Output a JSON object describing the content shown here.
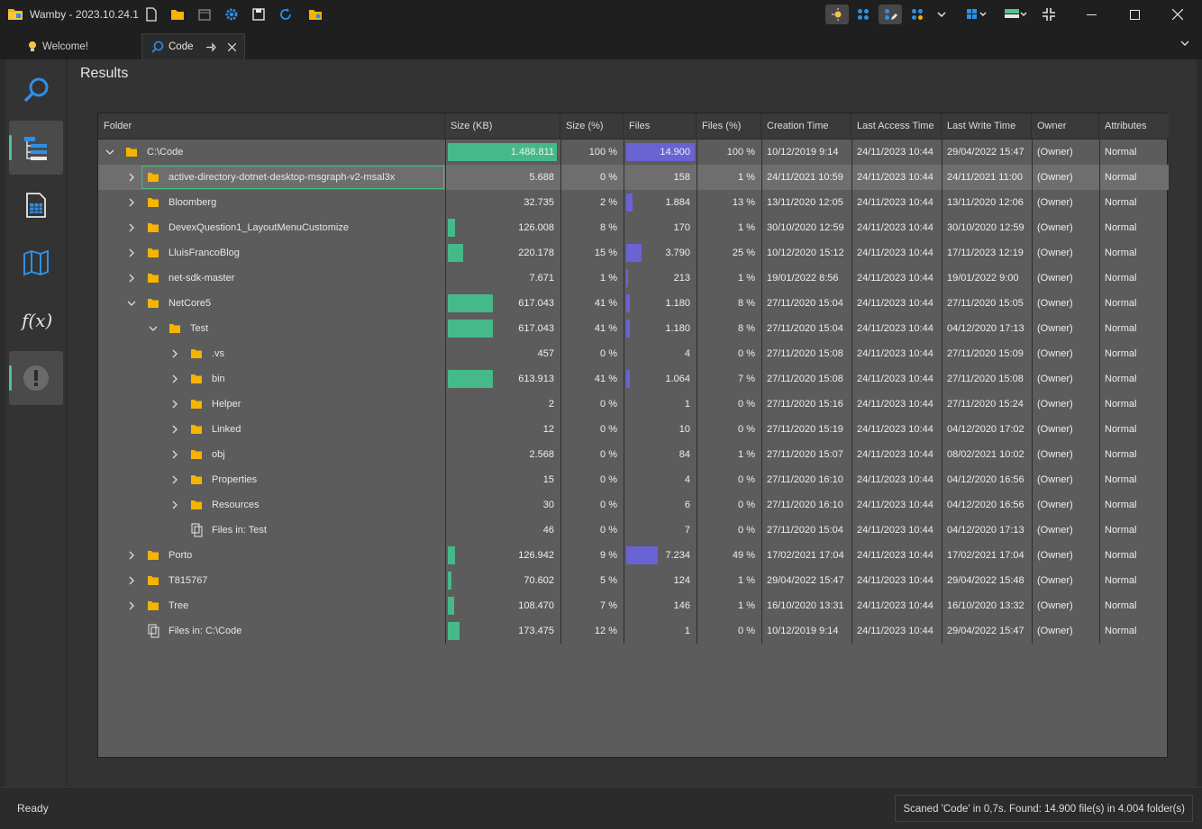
{
  "window": {
    "title": "Wamby - 2023.10.24.1"
  },
  "tabs": [
    {
      "label": "Welcome!"
    },
    {
      "label": "Code"
    }
  ],
  "main": {
    "title": "Results"
  },
  "grid": {
    "columns": [
      "Folder",
      "Size (KB)",
      "Size (%)",
      "Files",
      "Files (%)",
      "Creation Time",
      "Last Access Time",
      "Last Write Time",
      "Owner",
      "Attributes"
    ],
    "rows": [
      {
        "name": "C:\\Code",
        "level": 0,
        "expander": "expanded",
        "icon": "folder",
        "size": "1.488.811",
        "size_pct": "100 %",
        "size_frac": 1.0,
        "files": "14.900",
        "files_pct": "100 %",
        "files_frac": 1.0,
        "created": "10/12/2019 9:14",
        "accessed": "24/11/2023 10:44",
        "written": "29/04/2022 15:47",
        "owner": "(Owner)",
        "attr": "Normal"
      },
      {
        "name": "active-directory-dotnet-desktop-msgraph-v2-msal3x",
        "level": 1,
        "expander": "collapsed",
        "icon": "folder",
        "selected": true,
        "size": "5.688",
        "size_pct": "0 %",
        "size_frac": 0.0,
        "files": "158",
        "files_pct": "1 %",
        "files_frac": 0.0,
        "created": "24/11/2021 10:59",
        "accessed": "24/11/2023 10:44",
        "written": "24/11/2021 11:00",
        "owner": "(Owner)",
        "attr": "Normal"
      },
      {
        "name": "Bloomberg",
        "level": 1,
        "expander": "collapsed",
        "icon": "folder",
        "size": "32.735",
        "size_pct": "2 %",
        "size_frac": 0.0,
        "files": "1.884",
        "files_pct": "13 %",
        "files_frac": 0.09,
        "created": "13/11/2020 12:05",
        "accessed": "24/11/2023 10:44",
        "written": "13/11/2020 12:06",
        "owner": "(Owner)",
        "attr": "Normal"
      },
      {
        "name": "DevexQuestion1_LayoutMenuCustomize",
        "level": 1,
        "expander": "collapsed",
        "icon": "folder",
        "size": "126.008",
        "size_pct": "8 %",
        "size_frac": 0.07,
        "files": "170",
        "files_pct": "1 %",
        "files_frac": 0.0,
        "created": "30/10/2020 12:59",
        "accessed": "24/11/2023 10:44",
        "written": "30/10/2020 12:59",
        "owner": "(Owner)",
        "attr": "Normal"
      },
      {
        "name": "LluisFrancoBlog",
        "level": 1,
        "expander": "collapsed",
        "icon": "folder",
        "size": "220.178",
        "size_pct": "15 %",
        "size_frac": 0.14,
        "files": "3.790",
        "files_pct": "25 %",
        "files_frac": 0.22,
        "created": "10/12/2020 15:12",
        "accessed": "24/11/2023 10:44",
        "written": "17/11/2023 12:19",
        "owner": "(Owner)",
        "attr": "Normal"
      },
      {
        "name": "net-sdk-master",
        "level": 1,
        "expander": "collapsed",
        "icon": "folder",
        "size": "7.671",
        "size_pct": "1 %",
        "size_frac": 0.0,
        "files": "213",
        "files_pct": "1 %",
        "files_frac": 0.02,
        "created": "19/01/2022 8:56",
        "accessed": "24/11/2023 10:44",
        "written": "19/01/2022 9:00",
        "owner": "(Owner)",
        "attr": "Normal"
      },
      {
        "name": "NetCore5",
        "level": 1,
        "expander": "expanded",
        "icon": "folder",
        "size": "617.043",
        "size_pct": "41 %",
        "size_frac": 0.41,
        "files": "1.180",
        "files_pct": "8 %",
        "files_frac": 0.05,
        "created": "27/11/2020 15:04",
        "accessed": "24/11/2023 10:44",
        "written": "27/11/2020 15:05",
        "owner": "(Owner)",
        "attr": "Normal"
      },
      {
        "name": "Test",
        "level": 2,
        "expander": "expanded",
        "icon": "folder",
        "size": "617.043",
        "size_pct": "41 %",
        "size_frac": 0.41,
        "files": "1.180",
        "files_pct": "8 %",
        "files_frac": 0.05,
        "created": "27/11/2020 15:04",
        "accessed": "24/11/2023 10:44",
        "written": "04/12/2020 17:13",
        "owner": "(Owner)",
        "attr": "Normal"
      },
      {
        "name": ".vs",
        "level": 3,
        "expander": "collapsed",
        "icon": "folder",
        "size": "457",
        "size_pct": "0 %",
        "size_frac": 0.0,
        "files": "4",
        "files_pct": "0 %",
        "files_frac": 0.0,
        "created": "27/11/2020 15:08",
        "accessed": "24/11/2023 10:44",
        "written": "27/11/2020 15:09",
        "owner": "(Owner)",
        "attr": "Normal"
      },
      {
        "name": "bin",
        "level": 3,
        "expander": "collapsed",
        "icon": "folder",
        "size": "613.913",
        "size_pct": "41 %",
        "size_frac": 0.41,
        "files": "1.064",
        "files_pct": "7 %",
        "files_frac": 0.05,
        "created": "27/11/2020 15:08",
        "accessed": "24/11/2023 10:44",
        "written": "27/11/2020 15:08",
        "owner": "(Owner)",
        "attr": "Normal"
      },
      {
        "name": "Helper",
        "level": 3,
        "expander": "collapsed",
        "icon": "folder",
        "size": "2",
        "size_pct": "0 %",
        "size_frac": 0.0,
        "files": "1",
        "files_pct": "0 %",
        "files_frac": 0.0,
        "created": "27/11/2020 15:16",
        "accessed": "24/11/2023 10:44",
        "written": "27/11/2020 15:24",
        "owner": "(Owner)",
        "attr": "Normal"
      },
      {
        "name": "Linked",
        "level": 3,
        "expander": "collapsed",
        "icon": "folder",
        "size": "12",
        "size_pct": "0 %",
        "size_frac": 0.0,
        "files": "10",
        "files_pct": "0 %",
        "files_frac": 0.0,
        "created": "27/11/2020 15:19",
        "accessed": "24/11/2023 10:44",
        "written": "04/12/2020 17:02",
        "owner": "(Owner)",
        "attr": "Normal"
      },
      {
        "name": "obj",
        "level": 3,
        "expander": "collapsed",
        "icon": "folder",
        "size": "2.568",
        "size_pct": "0 %",
        "size_frac": 0.0,
        "files": "84",
        "files_pct": "1 %",
        "files_frac": 0.0,
        "created": "27/11/2020 15:07",
        "accessed": "24/11/2023 10:44",
        "written": "08/02/2021 10:02",
        "owner": "(Owner)",
        "attr": "Normal"
      },
      {
        "name": "Properties",
        "level": 3,
        "expander": "collapsed",
        "icon": "folder",
        "size": "15",
        "size_pct": "0 %",
        "size_frac": 0.0,
        "files": "4",
        "files_pct": "0 %",
        "files_frac": 0.0,
        "created": "27/11/2020 16:10",
        "accessed": "24/11/2023 10:44",
        "written": "04/12/2020 16:56",
        "owner": "(Owner)",
        "attr": "Normal"
      },
      {
        "name": "Resources",
        "level": 3,
        "expander": "collapsed",
        "icon": "folder",
        "size": "30",
        "size_pct": "0 %",
        "size_frac": 0.0,
        "files": "6",
        "files_pct": "0 %",
        "files_frac": 0.0,
        "created": "27/11/2020 16:10",
        "accessed": "24/11/2023 10:44",
        "written": "04/12/2020 16:56",
        "owner": "(Owner)",
        "attr": "Normal"
      },
      {
        "name": "Files in: Test",
        "level": 3,
        "expander": "none",
        "icon": "files",
        "size": "46",
        "size_pct": "0 %",
        "size_frac": 0.0,
        "files": "7",
        "files_pct": "0 %",
        "files_frac": 0.0,
        "created": "27/11/2020 15:04",
        "accessed": "24/11/2023 10:44",
        "written": "04/12/2020 17:13",
        "owner": "(Owner)",
        "attr": "Normal"
      },
      {
        "name": "Porto",
        "level": 1,
        "expander": "collapsed",
        "icon": "folder",
        "size": "126.942",
        "size_pct": "9 %",
        "size_frac": 0.07,
        "files": "7.234",
        "files_pct": "49 %",
        "files_frac": 0.46,
        "created": "17/02/2021 17:04",
        "accessed": "24/11/2023 10:44",
        "written": "17/02/2021 17:04",
        "owner": "(Owner)",
        "attr": "Normal"
      },
      {
        "name": "T815767",
        "level": 1,
        "expander": "collapsed",
        "icon": "folder",
        "size": "70.602",
        "size_pct": "5 %",
        "size_frac": 0.03,
        "files": "124",
        "files_pct": "1 %",
        "files_frac": 0.0,
        "created": "29/04/2022 15:47",
        "accessed": "24/11/2023 10:44",
        "written": "29/04/2022 15:48",
        "owner": "(Owner)",
        "attr": "Normal"
      },
      {
        "name": "Tree",
        "level": 1,
        "expander": "collapsed",
        "icon": "folder",
        "size": "108.470",
        "size_pct": "7 %",
        "size_frac": 0.06,
        "files": "146",
        "files_pct": "1 %",
        "files_frac": 0.0,
        "created": "16/10/2020 13:31",
        "accessed": "24/11/2023 10:44",
        "written": "16/10/2020 13:32",
        "owner": "(Owner)",
        "attr": "Normal"
      },
      {
        "name": "Files in: C:\\Code",
        "level": 1,
        "expander": "none",
        "icon": "files",
        "size": "173.475",
        "size_pct": "12 %",
        "size_frac": 0.11,
        "files": "1",
        "files_pct": "0 %",
        "files_frac": 0.0,
        "created": "10/12/2019 9:14",
        "accessed": "24/11/2023 10:44",
        "written": "29/04/2022 15:47",
        "owner": "(Owner)",
        "attr": "Normal"
      }
    ]
  },
  "status": {
    "left": "Ready",
    "right": "Scaned 'Code' in 0,7s. Found: 14.900 file(s) in 4.004 folder(s)"
  },
  "colors": {
    "size_bar": "#45b98a",
    "files_bar": "#6a63d4",
    "folder": "#f5b400",
    "accent_blue": "#2f8fe6",
    "selection_outline": "#3fbf7f"
  }
}
